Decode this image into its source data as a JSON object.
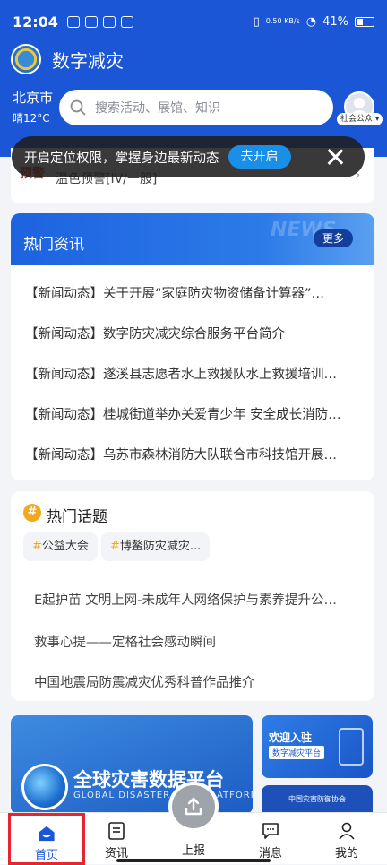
{
  "status_bar": {
    "time": "12:04",
    "net_speed": "0.50 KB/s",
    "battery": "41%"
  },
  "app": {
    "title": "数字减灾"
  },
  "location": {
    "city": "北京市",
    "weather": "晴12°C"
  },
  "search": {
    "placeholder": "搜索活动、展馆、知识"
  },
  "user": {
    "role": "社会公众"
  },
  "warning": {
    "logo_text": "预警",
    "text": "温色预警[IV/一般]"
  },
  "toast": {
    "message": "开启定位权限，掌握身边最新动态",
    "button": "去开启"
  },
  "news": {
    "title": "热门资讯",
    "banner_deco": "NEWS",
    "more": "更多",
    "items": [
      "【新闻动态】关于开展“家庭防灾物资储备计算器”…",
      "【新闻动态】数字防灾减灾综合服务平台简介",
      "【新闻动态】遂溪县志愿者水上救援队水上救援培训…",
      "【新闻动态】桂城街道举办关爱青少年 安全成长消防…",
      "【新闻动态】乌苏市森林消防大队联合市科技馆开展…"
    ]
  },
  "topics": {
    "title": "热门话题",
    "icon_char": "#",
    "tags": [
      {
        "hash": "#",
        "label": "公益大会"
      },
      {
        "hash": "#",
        "label": "博鳌防灾减灾..."
      }
    ],
    "items": [
      "E起护苗 文明上网-未成年人网络保护与素养提升公…",
      "救事心提——定格社会感动瞬间",
      "中国地震局防震减灾优秀科普作品推介"
    ]
  },
  "banner": {
    "title": "全球灾害数据平台",
    "subtitle": "GLOBAL DISASTER DATA PLATFORM"
  },
  "side_banner_1": {
    "line1": "欢迎入驻",
    "line2": "数字减灾平台"
  },
  "side_banner_2": {
    "text": "中国灾害防御协会"
  },
  "tabs": [
    {
      "label": "首页",
      "icon": "home-icon"
    },
    {
      "label": "资讯",
      "icon": "news-icon"
    },
    {
      "label": "上报",
      "icon": "upload-icon"
    },
    {
      "label": "消息",
      "icon": "message-icon"
    },
    {
      "label": "我的",
      "icon": "profile-icon"
    }
  ],
  "colors": {
    "brand": "#1a56d6",
    "accent": "#f2a81d",
    "highlight_border": "#e8252e"
  }
}
